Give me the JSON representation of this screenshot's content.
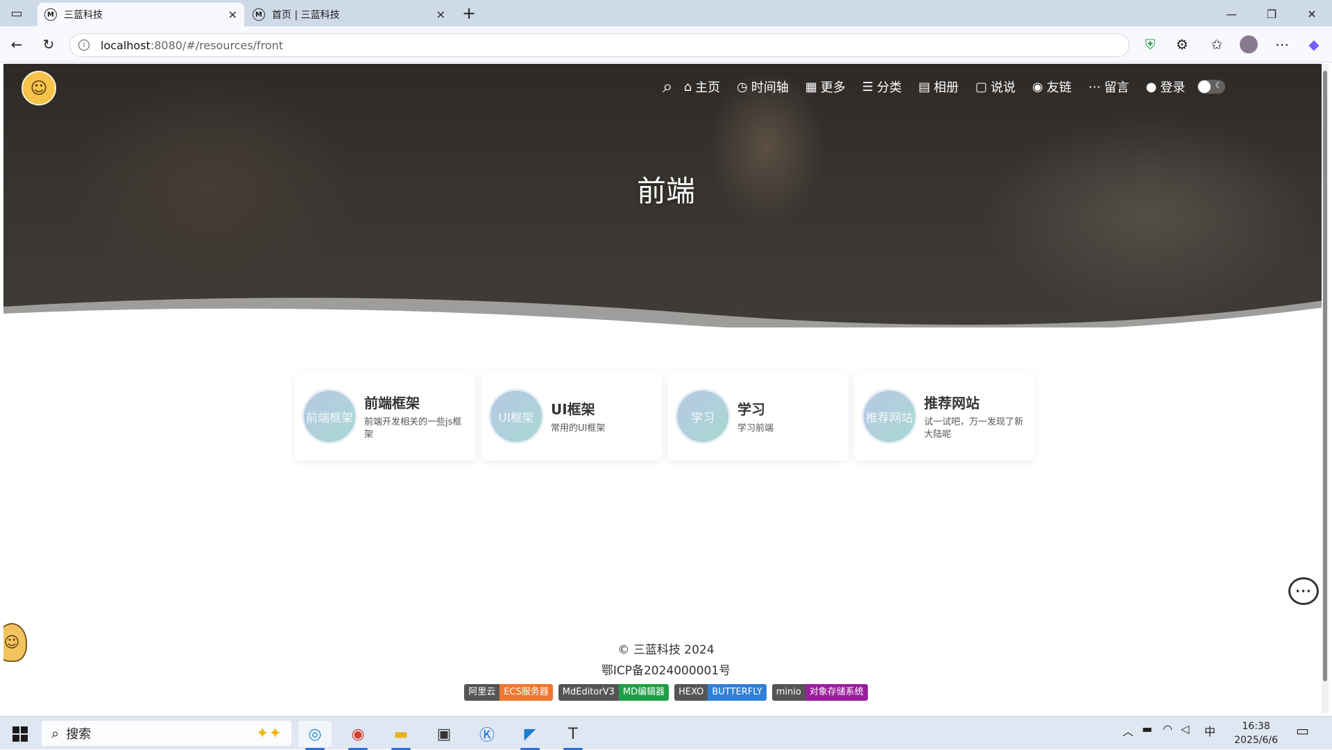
{
  "browser": {
    "tabs": [
      {
        "favicon": "M",
        "title": "三蓝科技",
        "active": true
      },
      {
        "favicon": "M",
        "title": "首页 | 三蓝科技",
        "active": false
      }
    ],
    "address": {
      "host": "localhost",
      "path": ":8080/#/resources/front"
    }
  },
  "site": {
    "logo_icon": "mascot-logo",
    "nav": {
      "items": [
        {
          "icon": "home-icon",
          "label": "主页"
        },
        {
          "icon": "timeline-icon",
          "label": "时间轴"
        },
        {
          "icon": "grid-icon",
          "label": "更多"
        },
        {
          "icon": "list-icon",
          "label": "分类"
        },
        {
          "icon": "document-icon",
          "label": "相册"
        },
        {
          "icon": "comment-icon",
          "label": "说说"
        },
        {
          "icon": "link-icon",
          "label": "友链"
        },
        {
          "icon": "message-icon",
          "label": "留言"
        },
        {
          "icon": "user-icon",
          "label": "登录"
        }
      ]
    },
    "hero_title": "前端"
  },
  "cards": [
    {
      "avatar_text": "前端框架",
      "title": "前端框架",
      "desc": "前端开发相关的一些js框架"
    },
    {
      "avatar_text": "UI框架",
      "title": "UI框架",
      "desc": "常用的UI框架"
    },
    {
      "avatar_text": "学习",
      "title": "学习",
      "desc": "学习前端"
    },
    {
      "avatar_text": "推荐网站",
      "title": "推荐网站",
      "desc": "试一试吧，万一发现了新大陆呢"
    }
  ],
  "footer": {
    "copyright": "© 三蓝科技 2024",
    "icp": "鄂ICP备2024000001号",
    "badges": [
      {
        "left": "阿里云",
        "right": "ECS服务器",
        "color": "#f0772f"
      },
      {
        "left": "MdEditorV3",
        "right": "MD编辑器",
        "color": "#1f9e48"
      },
      {
        "left": "HEXO",
        "right": "BUTTERFLY",
        "color": "#2f7fd6"
      },
      {
        "left": "minio",
        "right": "对象存储系统",
        "color": "#9c1d9e"
      }
    ]
  },
  "taskbar": {
    "search_placeholder": "搜索",
    "ime": "中",
    "time": "16:38",
    "date": "2025/6/6"
  }
}
